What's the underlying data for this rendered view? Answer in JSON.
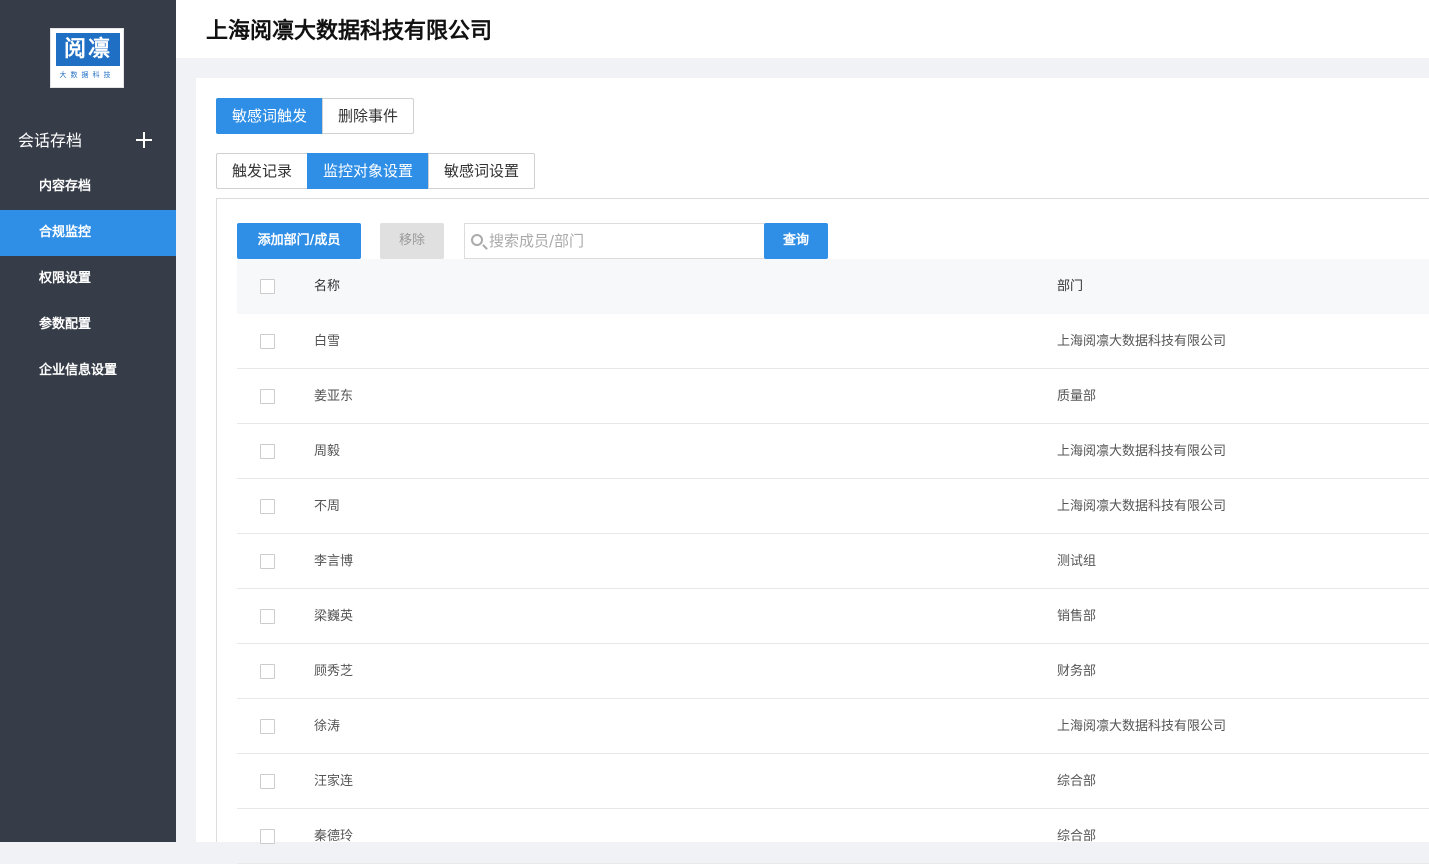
{
  "logo": {
    "main": "阅凛",
    "sub": "大数据科技"
  },
  "sidebar": {
    "group_label": "会话存档",
    "items": [
      {
        "label": "内容存档"
      },
      {
        "label": "合规监控"
      },
      {
        "label": "权限设置"
      },
      {
        "label": "参数配置"
      },
      {
        "label": "企业信息设置"
      }
    ]
  },
  "header": {
    "title": "上海阅凛大数据科技有限公司"
  },
  "top_tabs": [
    {
      "label": "敏感词触发"
    },
    {
      "label": "删除事件"
    }
  ],
  "sub_tabs": [
    {
      "label": "触发记录"
    },
    {
      "label": "监控对象设置"
    },
    {
      "label": "敏感词设置"
    }
  ],
  "toolbar": {
    "add_label": "添加部门/成员",
    "remove_label": "移除",
    "search_placeholder": "搜索成员/部门",
    "query_label": "查询"
  },
  "table": {
    "headers": {
      "name": "名称",
      "dept": "部门"
    },
    "rows": [
      {
        "name": "白雪",
        "dept": "上海阅凛大数据科技有限公司"
      },
      {
        "name": "姜亚东",
        "dept": "质量部"
      },
      {
        "name": "周毅",
        "dept": "上海阅凛大数据科技有限公司"
      },
      {
        "name": "不周",
        "dept": "上海阅凛大数据科技有限公司"
      },
      {
        "name": "李言博",
        "dept": "测试组"
      },
      {
        "name": "梁巍英",
        "dept": "销售部"
      },
      {
        "name": "顾秀芝",
        "dept": "财务部"
      },
      {
        "name": "徐涛",
        "dept": "上海阅凛大数据科技有限公司"
      },
      {
        "name": "汪家连",
        "dept": "综合部"
      },
      {
        "name": "秦德玲",
        "dept": "综合部"
      }
    ]
  },
  "colors": {
    "sidebar_bg": "#373d48",
    "accent": "#2f8fe6"
  }
}
